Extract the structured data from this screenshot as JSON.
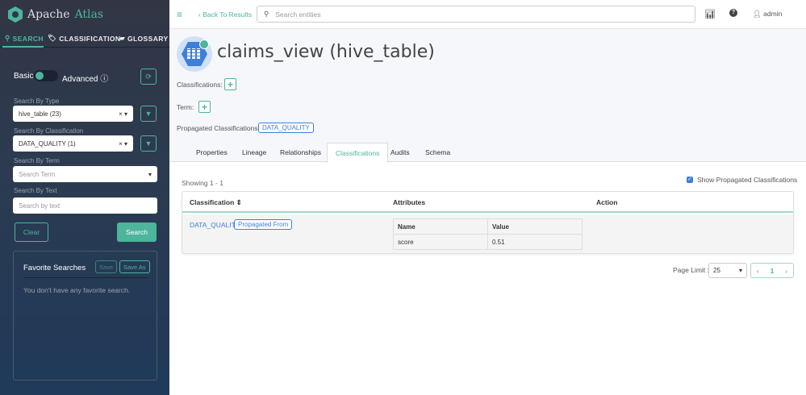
{
  "colors": {
    "accent": "#4cb59b",
    "link": "#3d7fd9",
    "sidebar_top": "#323544",
    "sidebar_bottom": "#1f3a5a"
  },
  "sidebar": {
    "logo": {
      "prefix": "Apache",
      "accent": "Atlas"
    },
    "tabs": [
      {
        "label": "SEARCH",
        "icon": "search-icon",
        "active": true
      },
      {
        "label": "CLASSIFICATION",
        "icon": "tag-icon"
      },
      {
        "label": "GLOSSARY",
        "icon": "folder-open-icon"
      }
    ],
    "toggle": {
      "left": "Basic",
      "right": "Advanced",
      "state": "basic"
    },
    "type": {
      "label": "Search By Type",
      "value": "hive_table (23)"
    },
    "classification": {
      "label": "Search By Classification",
      "value": "DATA_QUALITY (1)"
    },
    "term": {
      "label": "Search By Term",
      "placeholder": "Search Term"
    },
    "text": {
      "label": "Search By Text",
      "placeholder": "Search by text"
    },
    "clear": "Clear",
    "search": "Search",
    "favorites": {
      "title": "Favorite Searches",
      "save": "Save",
      "save_as": "Save As",
      "empty": "You don't have any favorite search."
    }
  },
  "header": {
    "back": "Back To Results",
    "search_placeholder": "Search entities",
    "user": "admin"
  },
  "entity": {
    "title": "claims_view (hive_table)",
    "classifications_label": "Classifications:",
    "term_label": "Term:",
    "propagated_label": "Propagated Classifications:",
    "propagated_tag": "DATA_QUALITY",
    "tabs": [
      "Properties",
      "Lineage",
      "Relationships",
      "Classifications",
      "Audits",
      "Schema"
    ],
    "active_tab": "Classifications"
  },
  "classifications": {
    "showing": "Showing 1 - 1",
    "show_propagated": "Show Propagated Classifications",
    "show_propagated_checked": true,
    "columns": [
      "Classification",
      "Attributes",
      "Action"
    ],
    "rows": [
      {
        "name": "DATA_QUALITY",
        "badge": "Propagated From",
        "attr_headers": [
          "Name",
          "Value"
        ],
        "attrs": [
          [
            "score",
            "0.51"
          ]
        ]
      }
    ],
    "page_limit_label": "Page Limit :",
    "page_limit": "25",
    "page": "1"
  }
}
